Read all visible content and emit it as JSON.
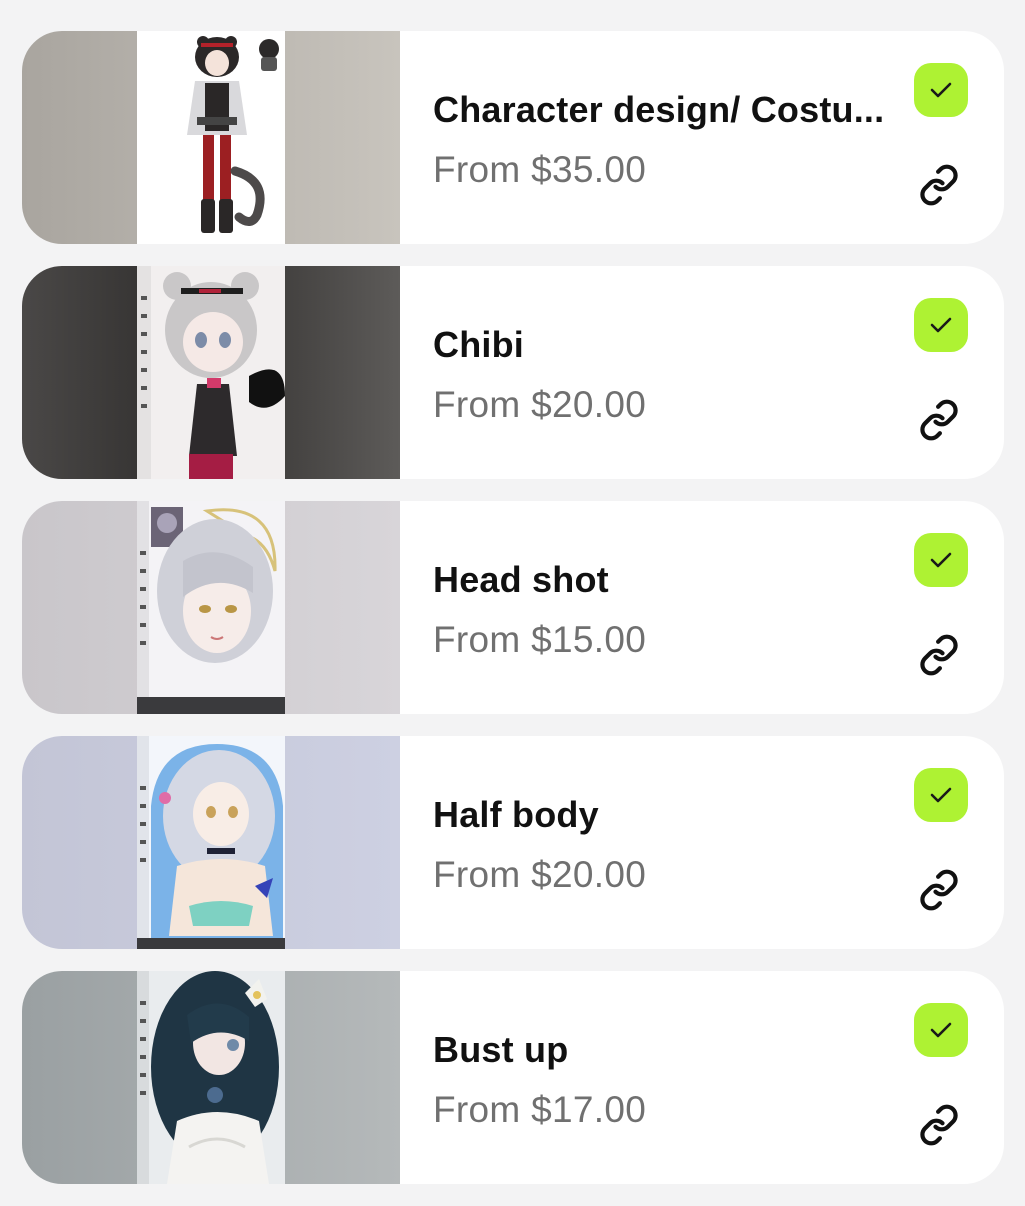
{
  "accent_color": "#aef233",
  "items": [
    {
      "title": "Character design/ Costu...",
      "price": "From $35.00",
      "image_icon": "character-design-artwork",
      "bg": "linear-gradient(90deg, #a9a59f 0%, #c8c4bd 100%)",
      "art_bg": "#ffffff"
    },
    {
      "title": "Chibi",
      "price": "From $20.00",
      "image_icon": "chibi-artwork",
      "bg": "linear-gradient(90deg, #4a4847 0%, #2f2d2c 45%, #5d5b59 100%)",
      "art_bg": "#f2efef"
    },
    {
      "title": "Head shot",
      "price": "From $15.00",
      "image_icon": "head-shot-artwork",
      "bg": "linear-gradient(90deg, #c9c6ca 0%, #d8d5d9 100%)",
      "art_bg": "#f4f3f6"
    },
    {
      "title": "Half body",
      "price": "From $20.00",
      "image_icon": "half-body-artwork",
      "bg": "linear-gradient(90deg, #c3c5d6 0%, #cdd0e2 100%)",
      "art_bg": "#cfe0f2"
    },
    {
      "title": "Bust up",
      "price": "From $17.00",
      "image_icon": "bust-up-artwork",
      "bg": "linear-gradient(90deg, #9aa0a2 0%, #b5b9ba 100%)",
      "art_bg": "#e9ecee"
    }
  ]
}
